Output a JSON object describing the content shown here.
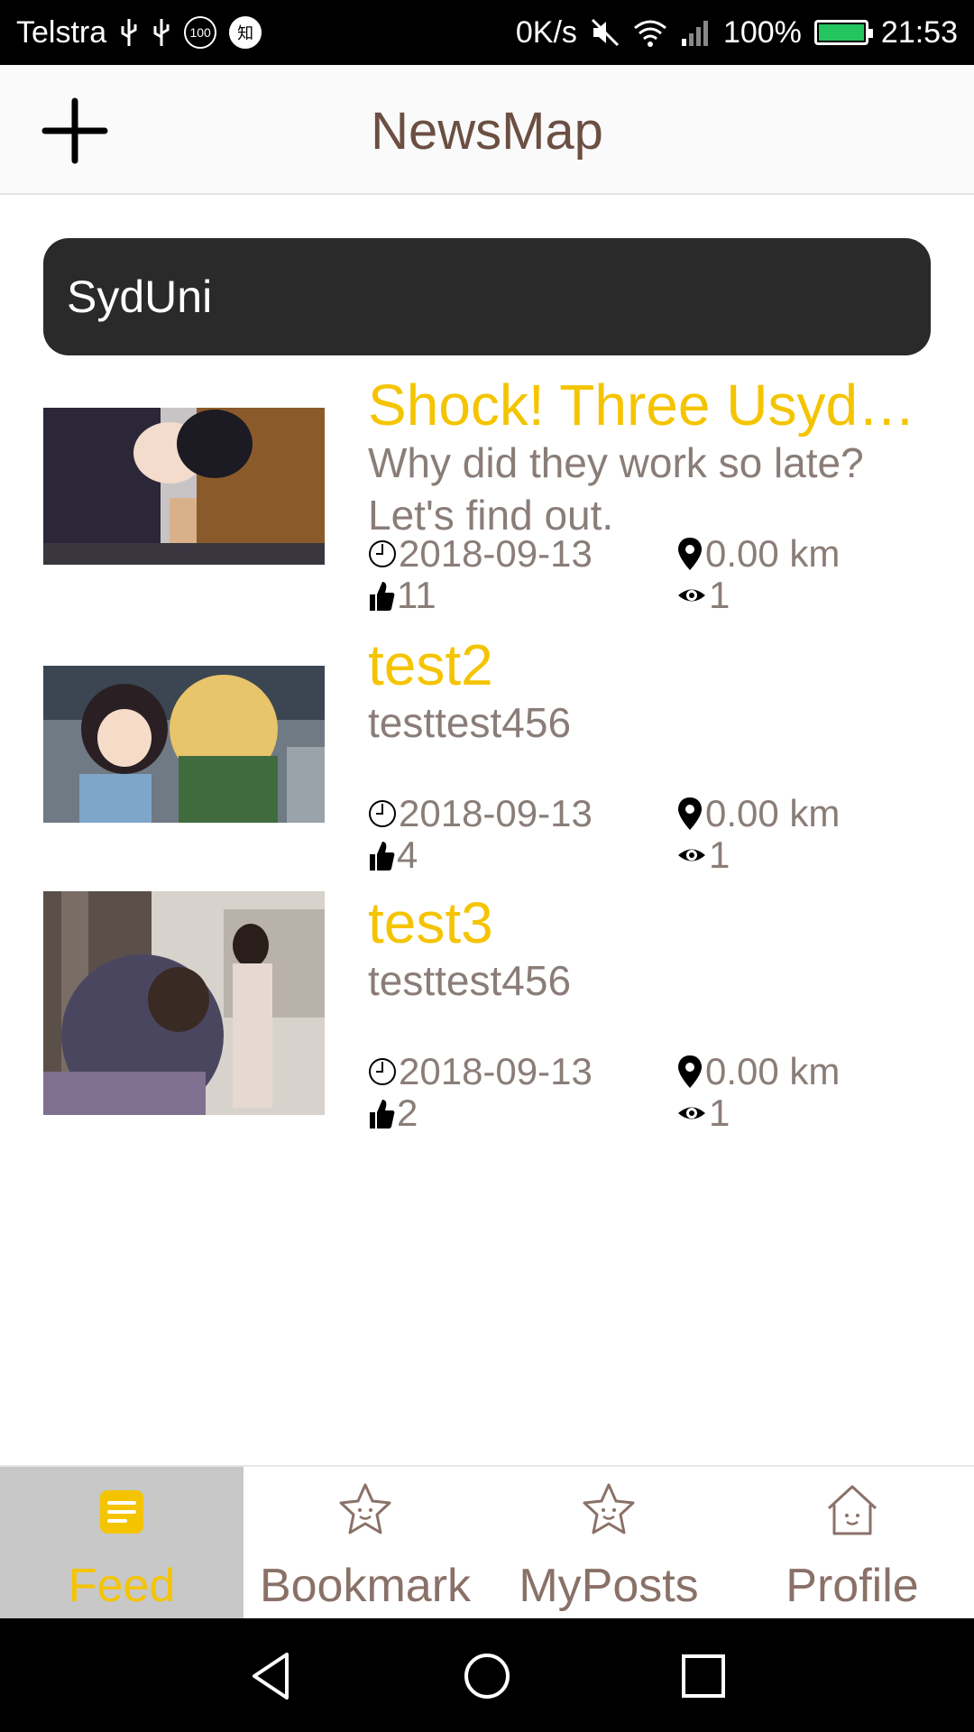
{
  "status_bar": {
    "carrier": "Telstra",
    "badge_100": "100",
    "badge_zhi": "知",
    "speed": "0K/s",
    "battery": "100%",
    "time": "21:53",
    "battery_color": "#22c55e"
  },
  "app_bar": {
    "title": "NewsMap",
    "add_icon": "plus-icon"
  },
  "search": {
    "value": "SydUni"
  },
  "feed": [
    {
      "title": "Shock! Three Usyd…",
      "summary_1": "Why did they work so late?",
      "summary_2": "Let's find out.",
      "date": "2018-09-13",
      "distance": "0.00 km",
      "likes": "11",
      "views": "1"
    },
    {
      "title": "test2",
      "summary_1": "testtest456",
      "summary_2": "",
      "date": "2018-09-13",
      "distance": "0.00 km",
      "likes": "4",
      "views": "1"
    },
    {
      "title": "test3",
      "summary_1": "testtest456",
      "summary_2": "",
      "date": "2018-09-13",
      "distance": "0.00 km",
      "likes": "2",
      "views": "1"
    }
  ],
  "bottom_nav": [
    {
      "label": "Feed",
      "icon": "feed-icon",
      "active": true
    },
    {
      "label": "Bookmark",
      "icon": "star-face-icon",
      "active": false
    },
    {
      "label": "MyPosts",
      "icon": "star-face-icon",
      "active": false
    },
    {
      "label": "Profile",
      "icon": "house-face-icon",
      "active": false
    }
  ],
  "colors": {
    "accent": "#f5c400",
    "title_text": "#6b4f42",
    "muted_text": "#8a7d78",
    "search_bg": "#2a2a2a",
    "active_tab_bg": "#c8c8c8"
  }
}
